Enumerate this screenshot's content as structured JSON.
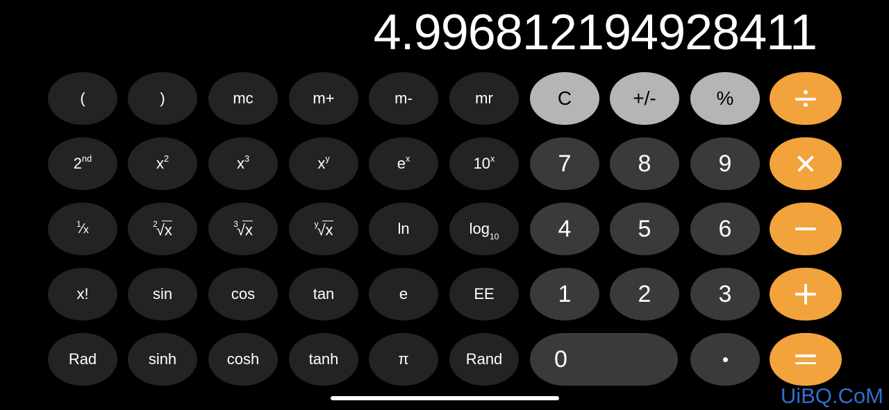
{
  "app": {
    "name": "Calculator",
    "orientation": "landscape-scientific",
    "theme": "dark"
  },
  "display": {
    "value": "4.996812194928411"
  },
  "colors": {
    "background": "#000000",
    "function_key": "#232323",
    "digit_key": "#3a3a3a",
    "top_row_key": "#b5b5b5",
    "operator_key": "#f2a33c",
    "text_light": "#ffffff",
    "text_dark": "#000000",
    "watermark": "#2f6fd0"
  },
  "watermark": {
    "text": "UiBQ.CoM"
  },
  "home_indicator": {
    "label": "home-indicator"
  },
  "keypad": {
    "rows": [
      {
        "keys": [
          {
            "label": "(",
            "name": "open-paren",
            "style": "fn"
          },
          {
            "label": ")",
            "name": "close-paren",
            "style": "fn"
          },
          {
            "label": "mc",
            "name": "memory-clear",
            "style": "fn"
          },
          {
            "label": "m+",
            "name": "memory-add",
            "style": "fn"
          },
          {
            "label": "m-",
            "name": "memory-subtract",
            "style": "fn"
          },
          {
            "label": "mr",
            "name": "memory-recall",
            "style": "fn"
          },
          {
            "label": "C",
            "name": "clear",
            "style": "top"
          },
          {
            "label": "+/-",
            "name": "sign-toggle",
            "style": "top"
          },
          {
            "label": "%",
            "name": "percent",
            "style": "top"
          },
          {
            "label": "÷",
            "name": "divide",
            "style": "op",
            "glyph": "divide-icon"
          }
        ]
      },
      {
        "keys": [
          {
            "label": "2nd",
            "name": "second-function",
            "style": "fn",
            "base": "2",
            "sup": "nd"
          },
          {
            "label": "x²",
            "name": "x-squared",
            "style": "fn",
            "base": "x",
            "sup": "2"
          },
          {
            "label": "x³",
            "name": "x-cubed",
            "style": "fn",
            "base": "x",
            "sup": "3"
          },
          {
            "label": "xʸ",
            "name": "x-to-the-y",
            "style": "fn",
            "base": "x",
            "sup": "y"
          },
          {
            "label": "eˣ",
            "name": "e-to-the-x",
            "style": "fn",
            "base": "e",
            "sup": "x"
          },
          {
            "label": "10ˣ",
            "name": "ten-to-the-x",
            "style": "fn",
            "base": "10",
            "sup": "x"
          },
          {
            "label": "7",
            "name": "digit-7",
            "style": "digit"
          },
          {
            "label": "8",
            "name": "digit-8",
            "style": "digit"
          },
          {
            "label": "9",
            "name": "digit-9",
            "style": "digit"
          },
          {
            "label": "×",
            "name": "multiply",
            "style": "op",
            "glyph": "multiply-icon"
          }
        ]
      },
      {
        "keys": [
          {
            "label": "1/x",
            "name": "reciprocal",
            "style": "fn",
            "frac": {
              "num": "1",
              "den": "x"
            }
          },
          {
            "label": "²√x",
            "name": "square-root",
            "style": "fn",
            "root": {
              "index": "2",
              "radicand": "x"
            }
          },
          {
            "label": "³√x",
            "name": "cube-root",
            "style": "fn",
            "root": {
              "index": "3",
              "radicand": "x"
            }
          },
          {
            "label": "ʸ√x",
            "name": "y-root-of-x",
            "style": "fn",
            "root": {
              "index": "y",
              "radicand": "x"
            }
          },
          {
            "label": "ln",
            "name": "natural-log",
            "style": "fn"
          },
          {
            "label": "log10",
            "name": "log-base-10",
            "style": "fn",
            "base": "log",
            "sub": "10"
          },
          {
            "label": "4",
            "name": "digit-4",
            "style": "digit"
          },
          {
            "label": "5",
            "name": "digit-5",
            "style": "digit"
          },
          {
            "label": "6",
            "name": "digit-6",
            "style": "digit"
          },
          {
            "label": "−",
            "name": "subtract",
            "style": "op",
            "glyph": "minus-icon"
          }
        ]
      },
      {
        "keys": [
          {
            "label": "x!",
            "name": "factorial",
            "style": "fn"
          },
          {
            "label": "sin",
            "name": "sine",
            "style": "fn"
          },
          {
            "label": "cos",
            "name": "cosine",
            "style": "fn"
          },
          {
            "label": "tan",
            "name": "tangent",
            "style": "fn"
          },
          {
            "label": "e",
            "name": "euler-constant",
            "style": "fn"
          },
          {
            "label": "EE",
            "name": "exponent-entry",
            "style": "fn"
          },
          {
            "label": "1",
            "name": "digit-1",
            "style": "digit"
          },
          {
            "label": "2",
            "name": "digit-2",
            "style": "digit"
          },
          {
            "label": "3",
            "name": "digit-3",
            "style": "digit"
          },
          {
            "label": "+",
            "name": "add",
            "style": "op",
            "glyph": "plus-icon"
          }
        ]
      },
      {
        "keys": [
          {
            "label": "Rad",
            "name": "radian-mode",
            "style": "fn"
          },
          {
            "label": "sinh",
            "name": "hyperbolic-sine",
            "style": "fn"
          },
          {
            "label": "cosh",
            "name": "hyperbolic-cosine",
            "style": "fn"
          },
          {
            "label": "tanh",
            "name": "hyperbolic-tangent",
            "style": "fn"
          },
          {
            "label": "π",
            "name": "pi-constant",
            "style": "fn"
          },
          {
            "label": "Rand",
            "name": "random-number",
            "style": "fn"
          },
          {
            "label": "0",
            "name": "digit-0",
            "style": "digit",
            "wide": true
          },
          {
            "label": ".",
            "name": "decimal-point",
            "style": "digit",
            "glyph": "dot-icon"
          },
          {
            "label": "=",
            "name": "equals",
            "style": "op",
            "glyph": "equals-icon"
          }
        ]
      }
    ]
  }
}
